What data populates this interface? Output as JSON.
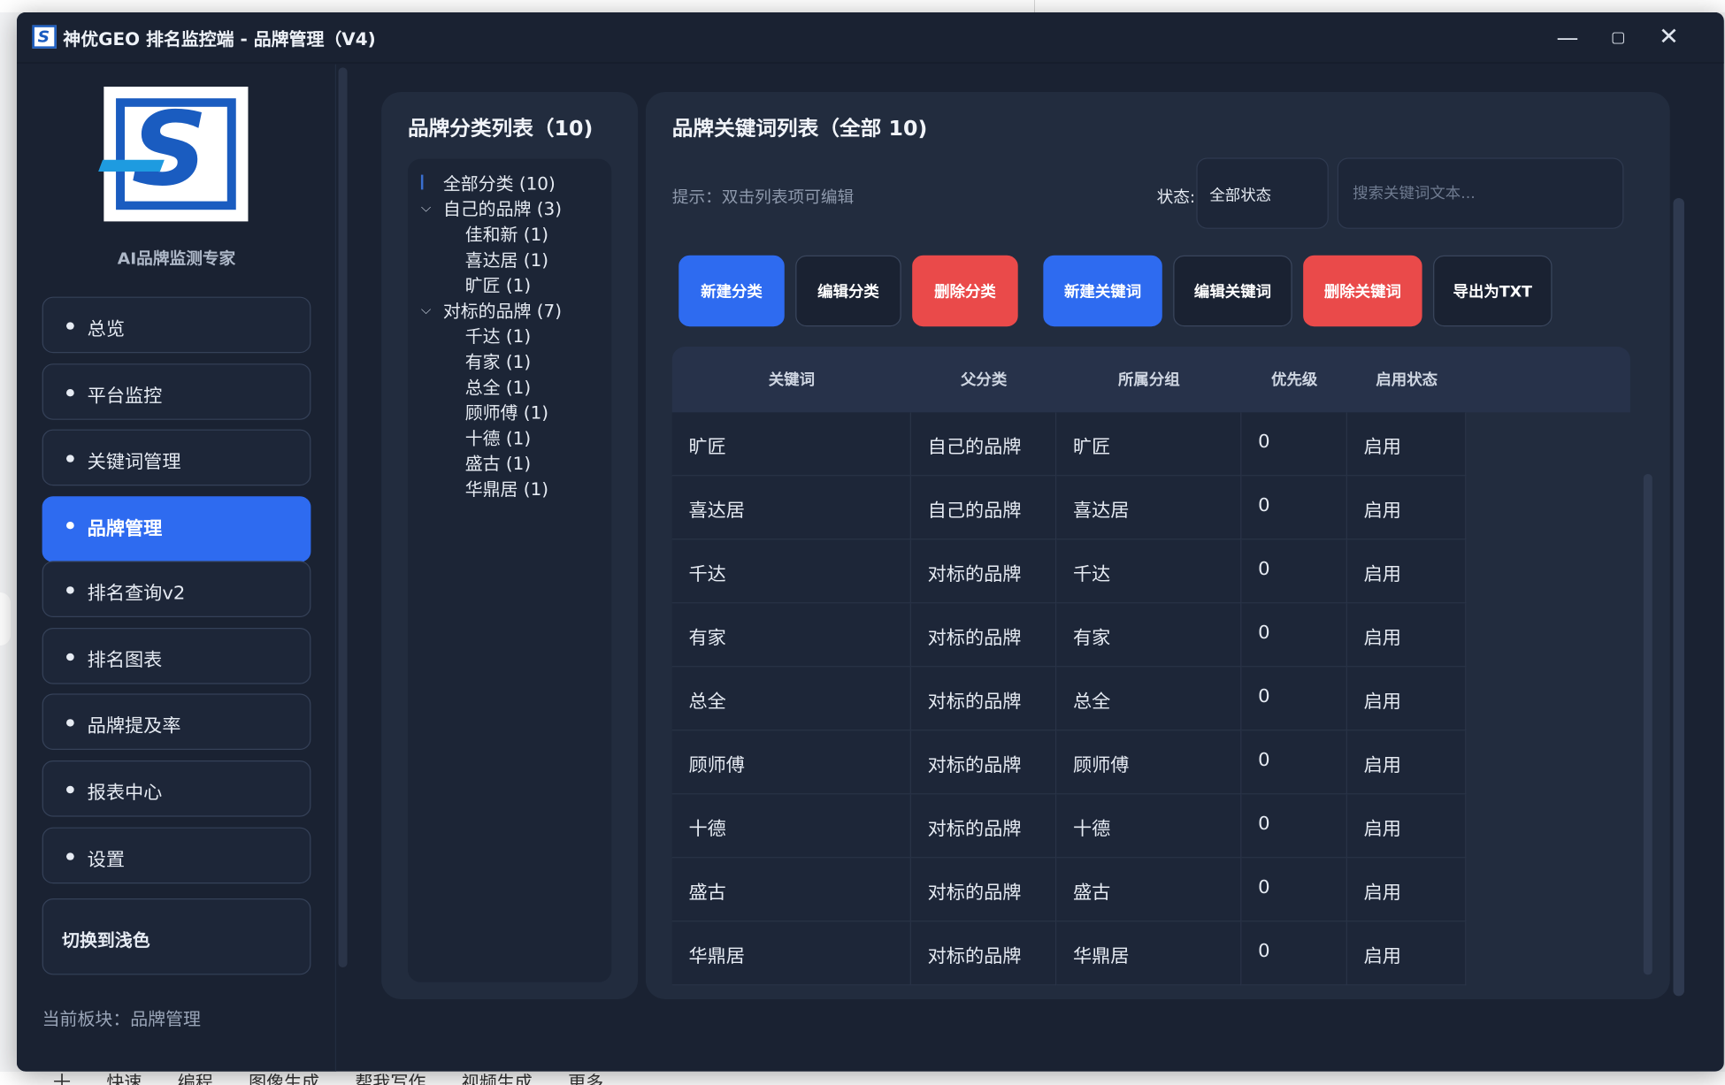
{
  "window": {
    "title": "神优GEO 排名监控端 - 品牌管理（V4)",
    "controls": [
      "—",
      "▢",
      "✕"
    ]
  },
  "sidebar": {
    "brand_sub": "AI品牌监测专家",
    "items": [
      {
        "label": "总览"
      },
      {
        "label": "平台监控"
      },
      {
        "label": "关键词管理"
      },
      {
        "label": "品牌管理",
        "active": true
      },
      {
        "label": "排名查询v2"
      },
      {
        "label": "排名图表"
      },
      {
        "label": "品牌提及率"
      },
      {
        "label": "报表中心"
      },
      {
        "label": "设置"
      }
    ],
    "theme_toggle": "切换到浅色",
    "current_section": "当前板块：品牌管理"
  },
  "categories": {
    "title": "品牌分类列表（10)",
    "tree": [
      {
        "label": "全部分类 (10)",
        "level": 0
      },
      {
        "label": "自己的品牌 (3)",
        "level": 0,
        "expanded": true
      },
      {
        "label": "佳和新 (1)",
        "level": 1
      },
      {
        "label": "喜达居 (1)",
        "level": 1
      },
      {
        "label": "旷匠 (1)",
        "level": 1
      },
      {
        "label": "对标的品牌 (7)",
        "level": 0,
        "expanded": true
      },
      {
        "label": "千达 (1)",
        "level": 1
      },
      {
        "label": "有家 (1)",
        "level": 1
      },
      {
        "label": "总全 (1)",
        "level": 1
      },
      {
        "label": "顾师傅 (1)",
        "level": 1
      },
      {
        "label": "十德 (1)",
        "level": 1
      },
      {
        "label": "盛古 (1)",
        "level": 1
      },
      {
        "label": "华鼎居 (1)",
        "level": 1
      }
    ]
  },
  "keywords": {
    "title": "品牌关键词列表（全部 10)",
    "hint": "提示：双击列表项可编辑",
    "status_label": "状态:",
    "status_value": "全部状态",
    "search_placeholder": "搜索关键词文本...",
    "buttons": {
      "new_category": "新建分类",
      "edit_category": "编辑分类",
      "delete_category": "删除分类",
      "new_keyword": "新建关键词",
      "edit_keyword": "编辑关键词",
      "delete_keyword": "删除关键词",
      "export_txt": "导出为TXT"
    },
    "columns": [
      "关键词",
      "父分类",
      "所属分组",
      "优先级",
      "启用状态"
    ],
    "rows": [
      [
        "旷匠",
        "自己的品牌",
        "旷匠",
        "0",
        "启用"
      ],
      [
        "喜达居",
        "自己的品牌",
        "喜达居",
        "0",
        "启用"
      ],
      [
        "千达",
        "对标的品牌",
        "千达",
        "0",
        "启用"
      ],
      [
        "有家",
        "对标的品牌",
        "有家",
        "0",
        "启用"
      ],
      [
        "总全",
        "对标的品牌",
        "总全",
        "0",
        "启用"
      ],
      [
        "顾师傅",
        "对标的品牌",
        "顾师傅",
        "0",
        "启用"
      ],
      [
        "十德",
        "对标的品牌",
        "十德",
        "0",
        "启用"
      ],
      [
        "盛古",
        "对标的品牌",
        "盛古",
        "0",
        "启用"
      ],
      [
        "华鼎居",
        "对标的品牌",
        "华鼎居",
        "0",
        "启用"
      ]
    ]
  },
  "background_taskbar": [
    "十",
    "快速",
    "编程",
    "图像生成",
    "帮我写作",
    "视频生成",
    "更多"
  ],
  "colors": {
    "accent": "#2e6bf0",
    "danger": "#ea4a4a",
    "window_bg": "#1a2232",
    "panel_bg": "#222c3e"
  }
}
